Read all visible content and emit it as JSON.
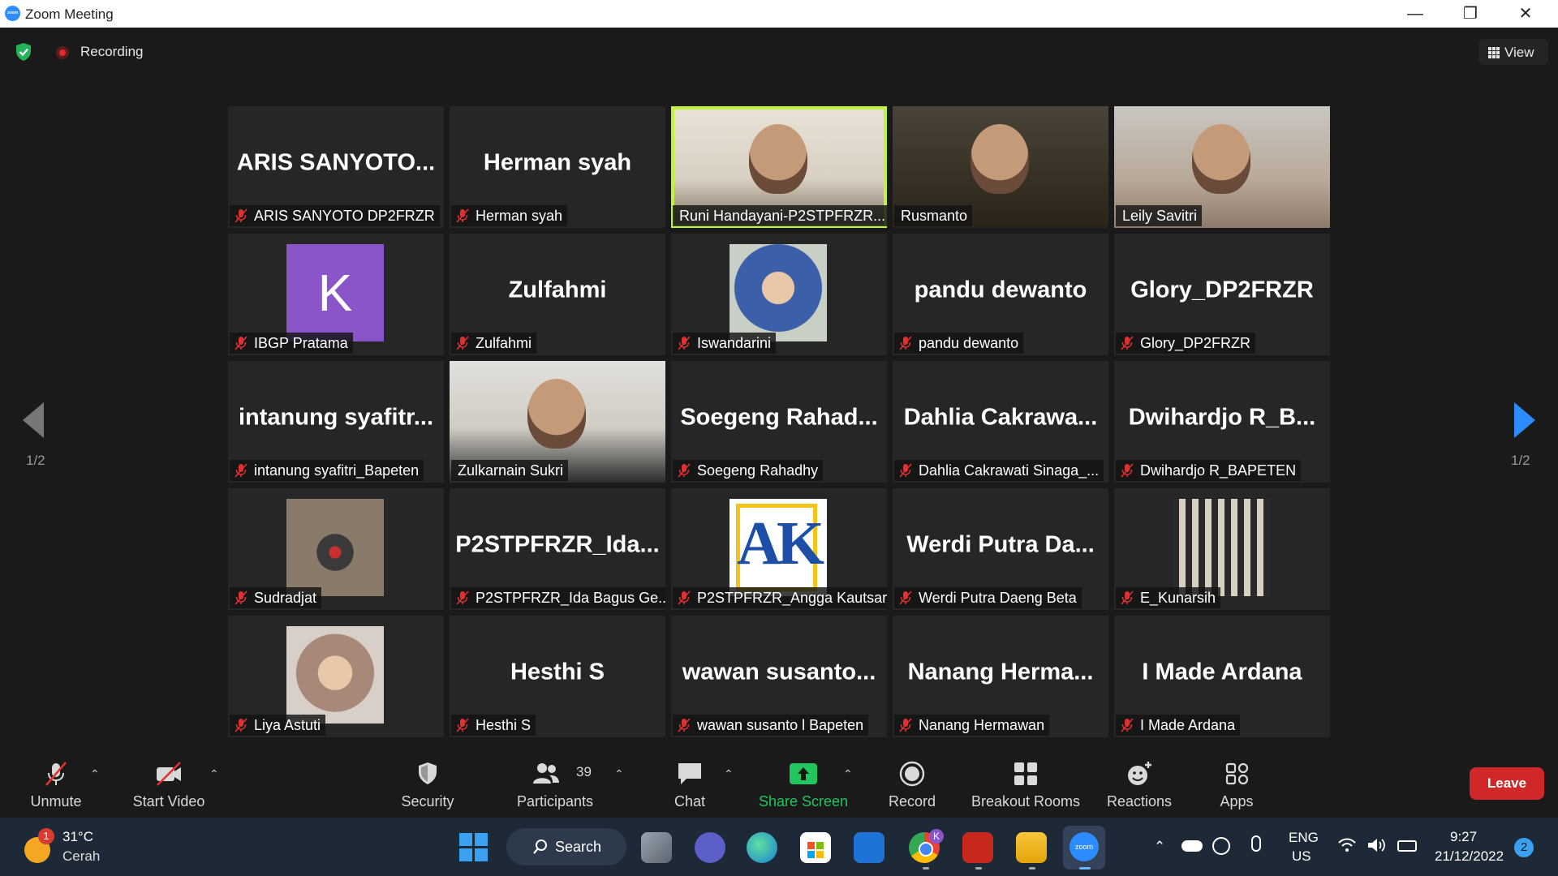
{
  "window": {
    "title": "Zoom Meeting",
    "brand_color": "#2d8cff",
    "logo_text": "zoom"
  },
  "topbar": {
    "recording_label": "Recording",
    "view_label": "View"
  },
  "pager": {
    "left_label": "1/2",
    "right_label": "1/2"
  },
  "tiles": [
    {
      "big": "ARIS  SANYOTO...",
      "name": "ARIS SANYOTO DP2FRZR",
      "kind": "text"
    },
    {
      "big": "Herman syah",
      "name": "Herman syah",
      "kind": "text"
    },
    {
      "big": "",
      "name": "Runi Handayani-P2STPFRZR...",
      "kind": "video",
      "active": true
    },
    {
      "big": "",
      "name": "Rusmanto",
      "kind": "video"
    },
    {
      "big": "",
      "name": "Leily Savitri",
      "kind": "video"
    },
    {
      "big": "",
      "name": "IBGP Pratama",
      "kind": "avatar-k",
      "avatar_letter": "K"
    },
    {
      "big": "Zulfahmi",
      "name": "Zulfahmi",
      "kind": "text"
    },
    {
      "big": "",
      "name": "Iswandarini",
      "kind": "photo"
    },
    {
      "big": "pandu dewanto",
      "name": "pandu dewanto",
      "kind": "text"
    },
    {
      "big": "Glory_DP2FRZR",
      "name": "Glory_DP2FRZR",
      "kind": "text"
    },
    {
      "big": "intanung  syafitr...",
      "name": "intanung syafitri_Bapeten",
      "kind": "text"
    },
    {
      "big": "",
      "name": "Zulkarnain Sukri",
      "kind": "video"
    },
    {
      "big": "Soegeng  Rahad...",
      "name": "Soegeng Rahadhy",
      "kind": "text"
    },
    {
      "big": "Dahlia  Cakrawa...",
      "name": "Dahlia Cakrawati Sinaga_...",
      "kind": "text"
    },
    {
      "big": "Dwihardjo  R_B...",
      "name": "Dwihardjo R_BAPETEN",
      "kind": "text"
    },
    {
      "big": "",
      "name": "Sudradjat",
      "kind": "photo"
    },
    {
      "big": "P2STPFRZR_Ida...",
      "name": "P2STPFRZR_Ida Bagus Ge...",
      "kind": "text"
    },
    {
      "big": "",
      "name": "P2STPFRZR_Angga Kautsar",
      "kind": "avatar-ak",
      "avatar_letter": "AK"
    },
    {
      "big": "Werdi  Putra  Da...",
      "name": "Werdi Putra Daeng Beta",
      "kind": "text"
    },
    {
      "big": "",
      "name": "E_Kunarsih",
      "kind": "photo"
    },
    {
      "big": "",
      "name": "Liya Astuti",
      "kind": "photo"
    },
    {
      "big": "Hesthi S",
      "name": "Hesthi S",
      "kind": "text"
    },
    {
      "big": "wawan  susanto...",
      "name": "wawan susanto l Bapeten",
      "kind": "text"
    },
    {
      "big": "Nanang  Herma...",
      "name": "Nanang Hermawan",
      "kind": "text"
    },
    {
      "big": "I Made Ardana",
      "name": "I Made Ardana",
      "kind": "text"
    }
  ],
  "toolbar": {
    "unmute": "Unmute",
    "start_video": "Start Video",
    "security": "Security",
    "participants": "Participants",
    "participants_count": "39",
    "chat": "Chat",
    "share_screen": "Share Screen",
    "record": "Record",
    "breakout_rooms": "Breakout Rooms",
    "reactions": "Reactions",
    "apps": "Apps",
    "leave": "Leave",
    "share_color": "#22c55e",
    "leave_color": "#d02828"
  },
  "taskbar": {
    "weather_temp": "31°C",
    "weather_desc": "Cerah",
    "weather_badge": "1",
    "search_label": "Search",
    "lang_top": "ENG",
    "lang_bottom": "US",
    "time": "9:27",
    "date": "21/12/2022",
    "notifications": "2",
    "teams_badge": "K"
  }
}
